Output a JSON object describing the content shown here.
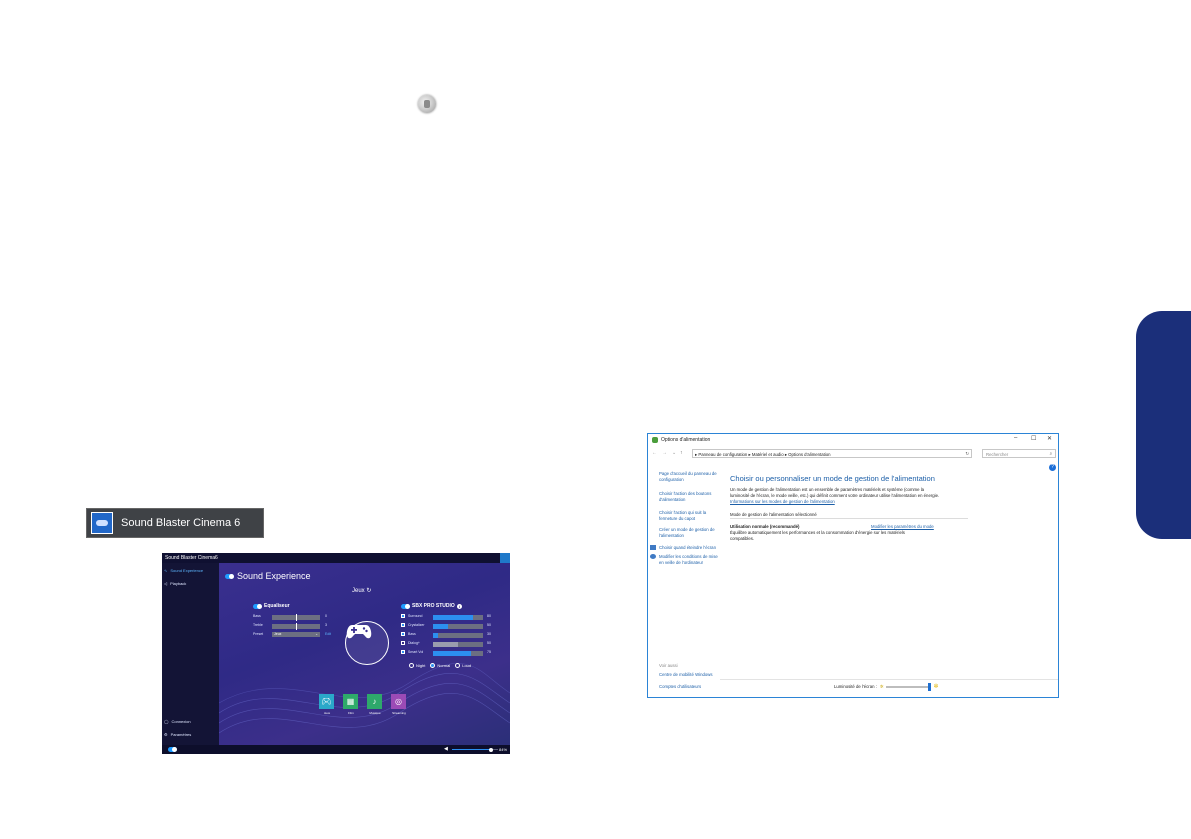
{
  "sound_blaster_tile": {
    "label": "Sound Blaster Cinema 6"
  },
  "sb_app": {
    "title": "Sound Blaster Cinema6",
    "nav": {
      "items": [
        "Sound Experience",
        "Playback"
      ],
      "bottom_items": [
        "Connexion",
        "Paramètres"
      ]
    },
    "header": "Sound Experience",
    "profile": "Jeux",
    "equalizer": {
      "title": "Equaliseur",
      "rows": [
        {
          "label": "Bass",
          "value": "0",
          "fraction": 0.5
        },
        {
          "label": "Treble",
          "value": "3",
          "fraction": 0.5
        }
      ],
      "preset_label": "Preset",
      "preset_value": "Jeux",
      "edit_label": "Edit"
    },
    "sbx": {
      "title": "SBX PRO STUDIO",
      "rows": [
        {
          "label": "Surround",
          "value": "80",
          "checked": true,
          "fraction": 0.8
        },
        {
          "label": "Crystalizer",
          "value": "50",
          "checked": true,
          "fraction": 0.3
        },
        {
          "label": "Bass",
          "value": "30",
          "checked": true,
          "fraction": 0.1
        },
        {
          "label": "Dialog+",
          "value": "50",
          "checked": false,
          "fraction": 0.5
        },
        {
          "label": "Smart Vol",
          "value": "75",
          "checked": true,
          "fraction": 0.75
        }
      ],
      "radios": [
        {
          "label": "Night",
          "selected": false
        },
        {
          "label": "Normal",
          "selected": true
        },
        {
          "label": "Loud",
          "selected": false
        }
      ]
    },
    "profiles": [
      {
        "label": "Jeux",
        "color": "#2aa8c9",
        "icon": "gamepad-icon"
      },
      {
        "label": "Film",
        "color": "#2eab6a",
        "icon": "film-icon"
      },
      {
        "label": "Musique",
        "color": "#2ea86b",
        "icon": "music-note-icon"
      },
      {
        "label": "Streaming",
        "color": "#9b4bb6",
        "icon": "stream-icon"
      }
    ],
    "volume": {
      "value": "84%",
      "fraction": 0.84
    }
  },
  "power_window": {
    "title": "Options d'alimentation",
    "address": "▸ Panneau de configuration ▸ Matériel et audio ▸ Options d'alimentation",
    "search_placeholder": "Rechercher",
    "left_links": [
      "Page d'accueil du panneau de configuration",
      "Choisir l'action des boutons d'alimentation",
      "Choisir l'action qui suit la fermeture du capot",
      "Créer un mode de gestion de l'alimentation",
      "Choisir quand éteindre l'écran",
      "Modifier les conditions de mise en veille de l'ordinateur"
    ],
    "see_also": "Voir aussi",
    "see_also_links": [
      "Centre de mobilité Windows",
      "Comptes d'utilisateurs"
    ],
    "heading": "Choisir ou personnaliser un mode de gestion de l'alimentation",
    "intro": "Un mode de gestion de l'alimentation est un ensemble de paramètres matériels et système (comme la luminosité de l'écran, le mode veille, etc.) qui définit comment votre ordinateur utilise l'alimentation en énergie.",
    "intro_link": "Informations sur les modes de gestion de l'alimentation",
    "selected_label": "Mode de gestion de l'alimentation sélectionné",
    "plan_name": "Utilisation normale (recommandé)",
    "plan_link": "Modifier les paramètres du mode",
    "plan_desc": "Équilibre automatiquement les performances et la consommation d'énergie sur les matériels compatibles.",
    "brightness_label": "Luminosité de l'écran :",
    "brightness_fraction": 1.0
  }
}
